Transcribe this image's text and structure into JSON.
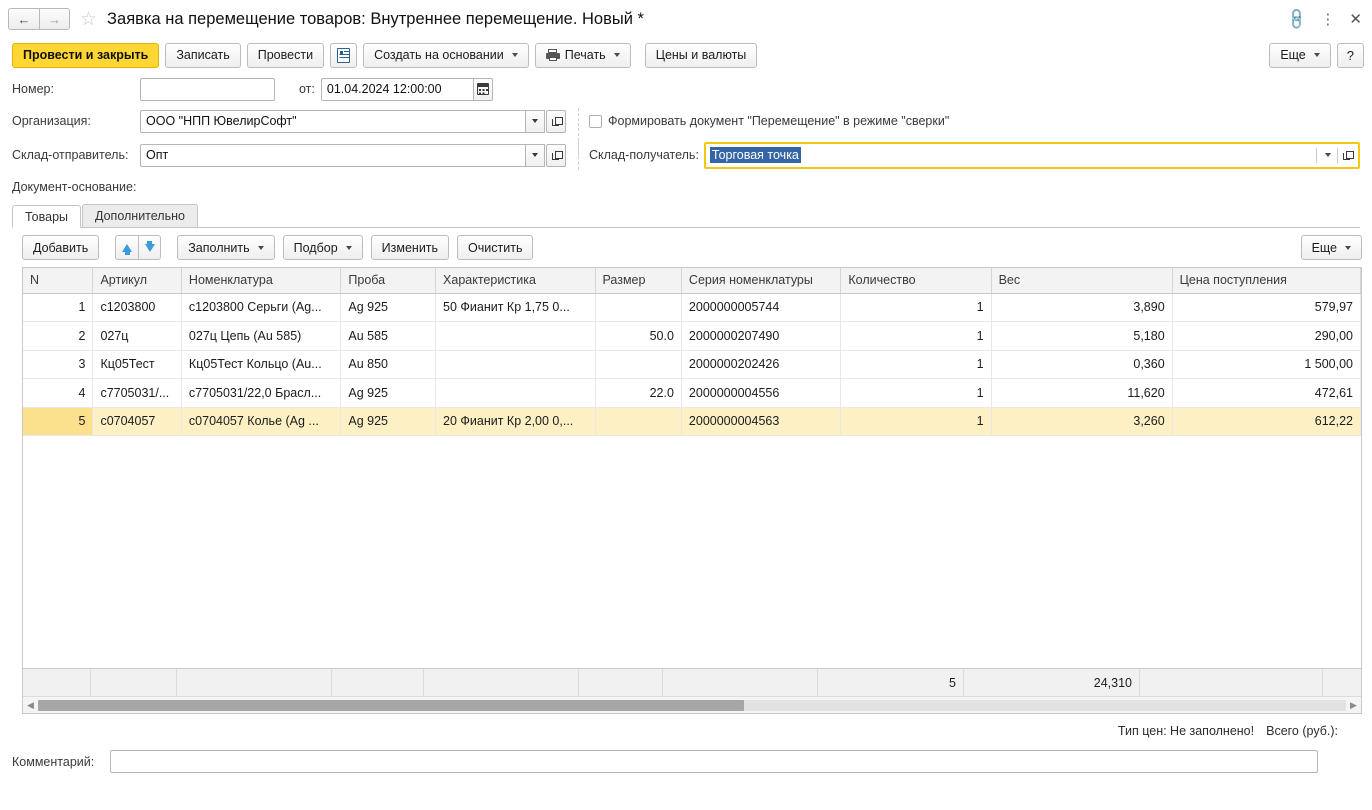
{
  "window": {
    "title": "Заявка на перемещение товаров: Внутреннее перемещение. Новый *",
    "back_icon": "arrow-left-icon",
    "forward_icon": "arrow-right-icon",
    "favorite_icon": "star-icon",
    "link_icon": "link-icon",
    "menu_icon": "kebab-menu-icon",
    "close_icon": "close-icon"
  },
  "commandbar": {
    "post_and_close": "Провести и закрыть",
    "save": "Записать",
    "post": "Провести",
    "register_icon": "document-register-icon",
    "create_based_on": "Создать на основании",
    "print": "Печать",
    "prices_and_currencies": "Цены и валюты",
    "more": "Еще",
    "help": "?"
  },
  "header_form": {
    "number_label": "Номер:",
    "number_value": "",
    "date_label": "от:",
    "date_value": "01.04.2024 12:00:00",
    "calendar_icon": "calendar-icon",
    "organization_label": "Организация:",
    "organization_value": "ООО \"НПП ЮвелирСофт\"",
    "warehouse_from_label": "Склад-отправитель:",
    "warehouse_from_value": "Опт",
    "checkbox_label": "Формировать документ \"Перемещение\" в режиме \"сверки\"",
    "checkbox_checked": false,
    "warehouse_to_label": "Склад-получатель:",
    "warehouse_to_value": "Торговая точка",
    "base_document_label": "Документ-основание:",
    "base_document_value": "",
    "dropdown_icon": "chevron-down-icon",
    "open_icon": "open-external-icon"
  },
  "tabs": [
    {
      "label": "Товары",
      "active": true
    },
    {
      "label": "Дополнительно",
      "active": false
    }
  ],
  "table_toolbar": {
    "add": "Добавить",
    "move_up_icon": "arrow-up-icon",
    "move_down_icon": "arrow-down-icon",
    "fill": "Заполнить",
    "select": "Подбор",
    "change": "Изменить",
    "clear": "Очистить",
    "more": "Еще"
  },
  "table": {
    "columns": [
      "N",
      "Артикул",
      "Номенклатура",
      "Проба",
      "Характеристика",
      "Размер",
      "Серия номенклатуры",
      "Количество",
      "Вес",
      "Цена поступления"
    ],
    "rows": [
      {
        "n": "1",
        "article": "с1203800",
        "nomenclature": "с1203800 Серьги (Ag...",
        "assay": "Ag 925",
        "characteristic": "50 Фианит Кр 1,75  0...",
        "size": "",
        "series": "2000000005744",
        "quantity": "1",
        "weight": "3,890",
        "price": "579,97",
        "selected": false
      },
      {
        "n": "2",
        "article": "027ц",
        "nomenclature": "027ц Цепь (Au 585)",
        "assay": "Au 585",
        "characteristic": "",
        "size": "50.0",
        "series": "2000000207490",
        "quantity": "1",
        "weight": "5,180",
        "price": "290,00",
        "selected": false
      },
      {
        "n": "3",
        "article": "Кц05Тест",
        "nomenclature": "Кц05Тест Кольцо (Au...",
        "assay": "Au 850",
        "characteristic": "",
        "size": "",
        "series": "2000000202426",
        "quantity": "1",
        "weight": "0,360",
        "price": "1 500,00",
        "selected": false
      },
      {
        "n": "4",
        "article": "с7705031/...",
        "nomenclature": "с7705031/22,0 Брасл...",
        "assay": "Ag 925",
        "characteristic": "",
        "size": "22.0",
        "series": "2000000004556",
        "quantity": "1",
        "weight": "11,620",
        "price": "472,61",
        "selected": false
      },
      {
        "n": "5",
        "article": "с0704057",
        "nomenclature": "с0704057 Колье (Ag ...",
        "assay": "Ag 925",
        "characteristic": "20 Фианит Кр 2,00 0,...",
        "size": "",
        "series": "2000000004563",
        "quantity": "1",
        "weight": "3,260",
        "price": "612,22",
        "selected": true
      }
    ],
    "totals": {
      "quantity": "5",
      "weight": "24,310"
    }
  },
  "footer": {
    "price_type": "Тип цен: Не заполнено!",
    "total_label": "Всего (руб.):",
    "total_value": "",
    "comment_label": "Комментарий:",
    "comment_value": ""
  },
  "colors": {
    "accent_yellow": "#ffd633",
    "focus_border": "#f2c811",
    "selection_blue": "#3465a4",
    "row_selected": "#fdf0c4"
  }
}
